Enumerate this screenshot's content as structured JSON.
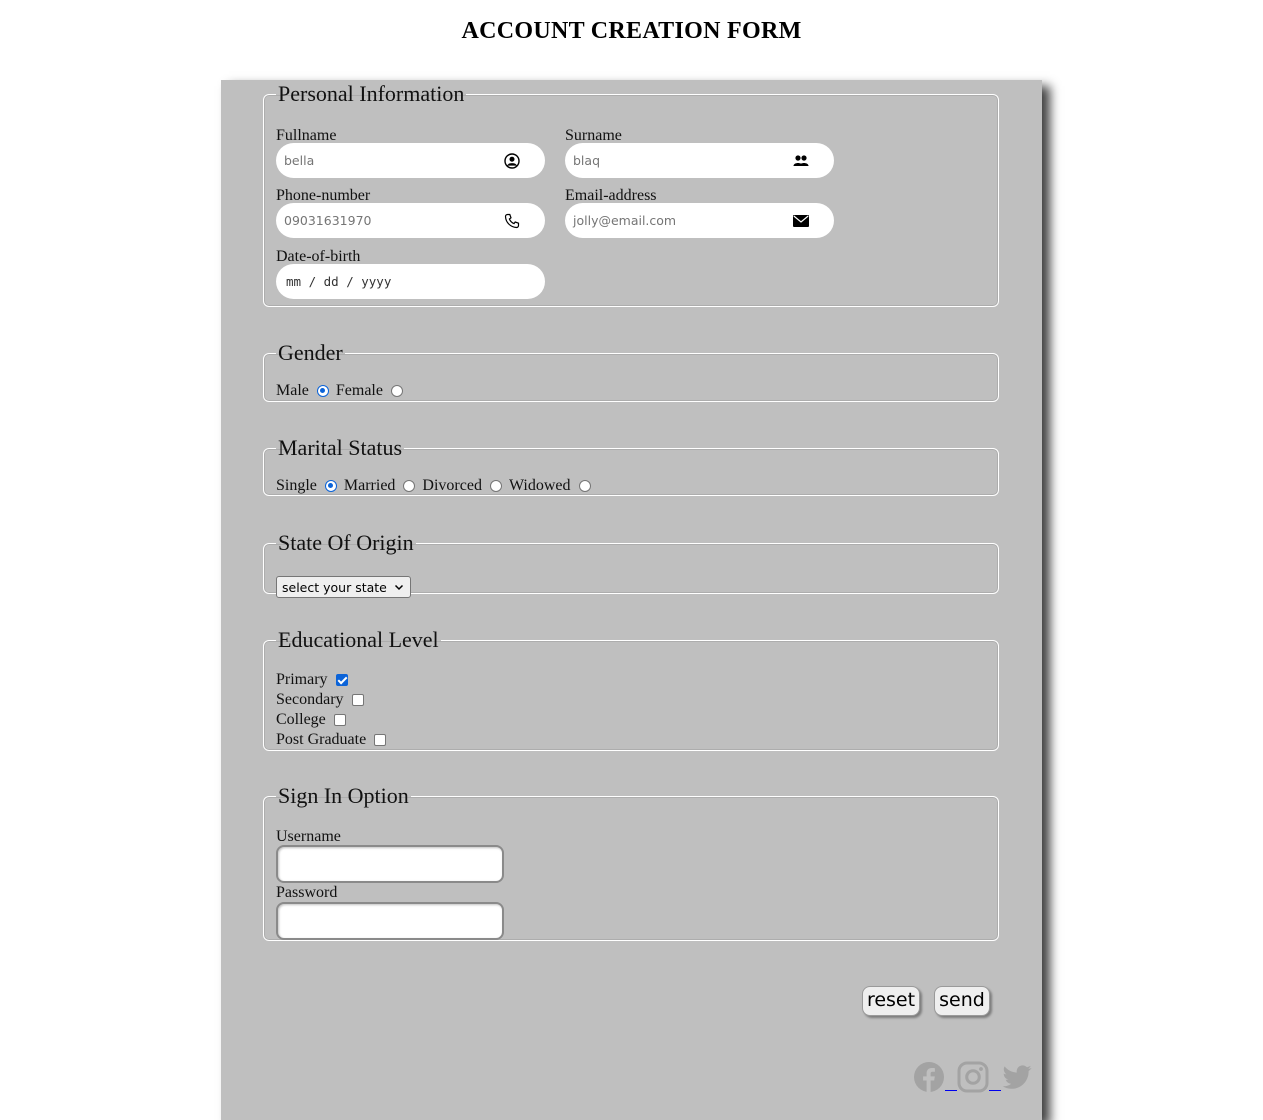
{
  "page": {
    "title": "ACCOUNT CREATION FORM"
  },
  "personal": {
    "legend": "Personal Information",
    "fullname": {
      "label": "Fullname",
      "placeholder": "bella",
      "icon": "user-circle-icon"
    },
    "surname": {
      "label": "Surname",
      "placeholder": "blaq",
      "icon": "users-icon"
    },
    "phone": {
      "label": "Phone-number",
      "placeholder": "09031631970",
      "icon": "phone-icon"
    },
    "email": {
      "label": "Email-address",
      "placeholder": "jolly@email.com",
      "icon": "envelope-icon"
    },
    "dob": {
      "label": "Date-of-birth",
      "placeholder": "mm / dd / yyyy"
    }
  },
  "gender": {
    "legend": "Gender",
    "options": [
      {
        "label": "Male",
        "checked": true
      },
      {
        "label": "Female",
        "checked": false
      }
    ]
  },
  "marital": {
    "legend": "Marital Status",
    "options": [
      {
        "label": "Single",
        "checked": true
      },
      {
        "label": "Married",
        "checked": false
      },
      {
        "label": "Divorced",
        "checked": false
      },
      {
        "label": "Widowed",
        "checked": false
      }
    ]
  },
  "state": {
    "legend": "State Of Origin",
    "selected": "select your state"
  },
  "education": {
    "legend": "Educational Level",
    "options": [
      {
        "label": "Primary",
        "checked": true
      },
      {
        "label": "Secondary",
        "checked": false
      },
      {
        "label": "College",
        "checked": false
      },
      {
        "label": "Post Graduate",
        "checked": false
      }
    ]
  },
  "signin": {
    "legend": "Sign In Option",
    "username_label": "Username",
    "username_value": "",
    "password_label": "Password",
    "password_value": ""
  },
  "actions": {
    "reset_label": "reset",
    "send_label": "send"
  },
  "social": [
    "facebook-icon",
    "instagram-icon",
    "twitter-icon"
  ],
  "colors": {
    "panel": "#bfbfbf",
    "accent": "#0b63d8",
    "social_icon": "#a3a3a3"
  }
}
